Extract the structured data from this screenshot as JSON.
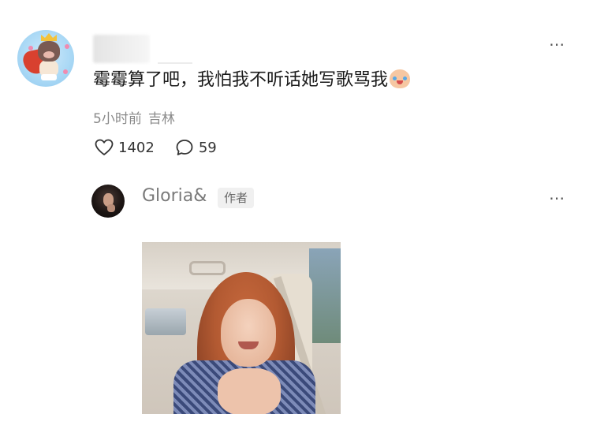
{
  "comment": {
    "text": "霉霉算了吧，我怕我不听话她写歌骂我",
    "emoji": "crying-laughing-face-emoji",
    "time": "5小时前",
    "location": "吉林",
    "likes": "1402",
    "replies": "59",
    "more_icon": "⋯"
  },
  "reply": {
    "username": "Gloria&",
    "badge": "作者",
    "more_icon": "⋯"
  },
  "colors": {
    "meta_text": "#8a8a8a",
    "name_text": "#7a7a7a",
    "badge_bg": "#f0f0f0"
  }
}
